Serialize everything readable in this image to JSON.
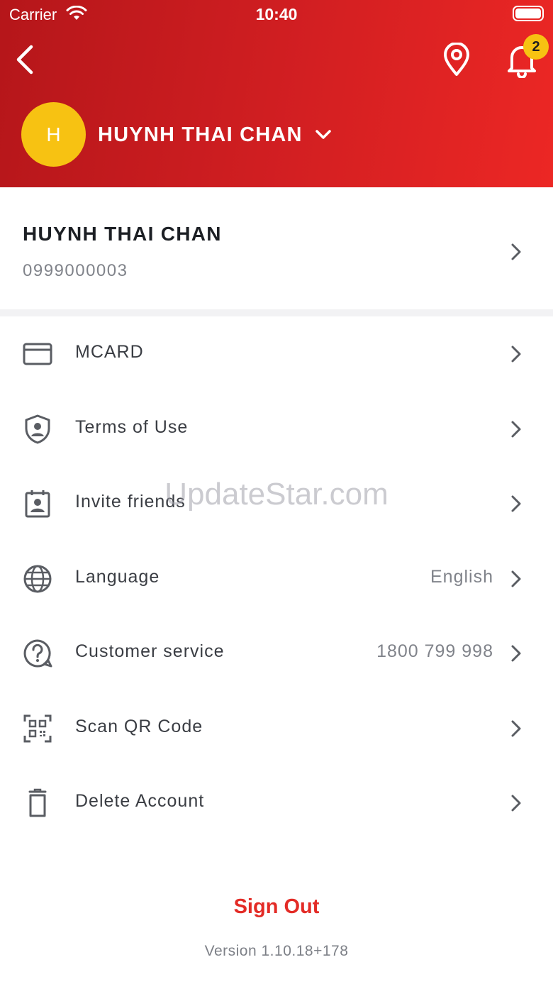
{
  "status_bar": {
    "carrier": "Carrier",
    "time": "10:40"
  },
  "header": {
    "notification_count": "2",
    "avatar_initial": "H",
    "account_name": "HUYNH THAI CHAN",
    "icons": [
      "back-icon",
      "location-pin-icon",
      "bell-icon",
      "chevron-down-icon"
    ],
    "gradient_colors": [
      "#b5161a",
      "#ec2724"
    ]
  },
  "profile": {
    "name": "HUYNH THAI CHAN",
    "phone": "0999000003"
  },
  "menu": [
    {
      "icon": "card-icon",
      "label": "MCARD",
      "value": ""
    },
    {
      "icon": "shield-user-icon",
      "label": "Terms of Use",
      "value": ""
    },
    {
      "icon": "contact-calendar-icon",
      "label": "Invite friends",
      "value": ""
    },
    {
      "icon": "globe-icon",
      "label": "Language",
      "value": "English"
    },
    {
      "icon": "help-chat-icon",
      "label": "Customer service",
      "value": "1800 799 998"
    },
    {
      "icon": "qr-code-icon",
      "label": "Scan QR Code",
      "value": ""
    },
    {
      "icon": "trash-icon",
      "label": "Delete Account",
      "value": ""
    }
  ],
  "sign_out_label": "Sign Out",
  "version": "Version 1.10.18+178",
  "watermark": "UpdateStar.com",
  "colors": {
    "accent_red": "#e32b26",
    "avatar_yellow": "#f7c212",
    "text_dark": "#1c1f24",
    "text_muted": "#80838a"
  }
}
